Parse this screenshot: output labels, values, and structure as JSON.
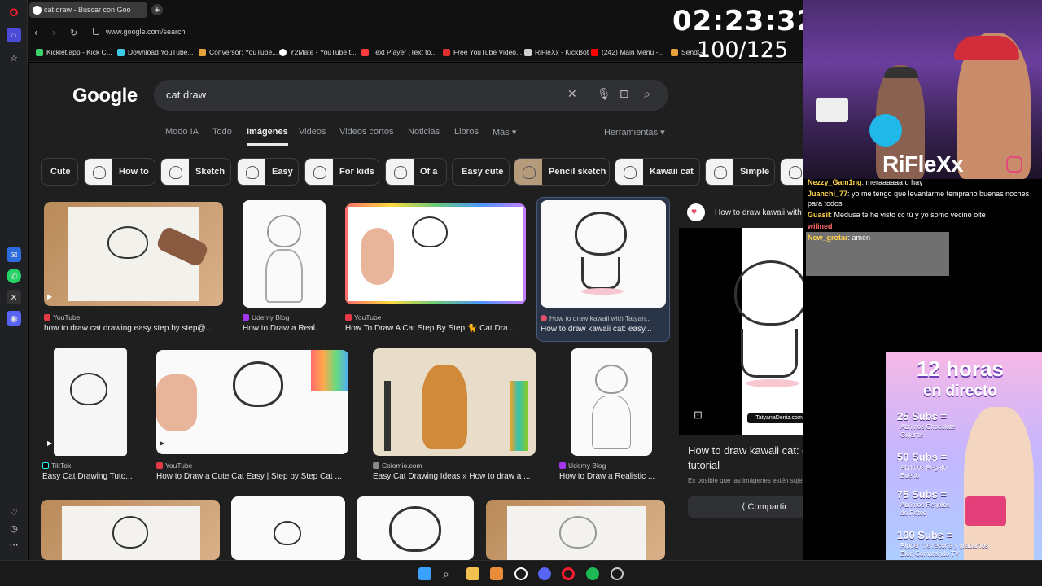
{
  "browser": {
    "tab_title": "cat draw - Buscar con Goo",
    "url": "www.google.com/search",
    "bookmarks": [
      {
        "label": "Kicklet.app - Kick C...",
        "color": "#3ad16b"
      },
      {
        "label": "Download YouTube...",
        "color": "#3ecbe6"
      },
      {
        "label": "Conversor: YouTube...",
        "color": "#e2a33a"
      },
      {
        "label": "Y2Mate - YouTube t...",
        "color": "#ffffff"
      },
      {
        "label": "Text Player (Text to...",
        "color": "#ff3b3b"
      },
      {
        "label": "Free YouTube Video...",
        "color": "#e03131"
      },
      {
        "label": "RiFleXx - KickBot",
        "color": "#d0d0d0"
      },
      {
        "label": "(242) Main Menu -...",
        "color": "#ff0000"
      },
      {
        "label": "SendG...",
        "color": "#e8a33a"
      }
    ]
  },
  "google": {
    "logo": "Google",
    "query": "cat draw",
    "tabs": [
      "Modo IA",
      "Todo",
      "Imágenes",
      "Videos",
      "Videos cortos",
      "Noticias",
      "Libros",
      "Más ▾"
    ],
    "active_tab": "Imágenes",
    "tools": "Herramientas ▾",
    "chips": [
      "Cute",
      "How to",
      "Sketch",
      "Easy",
      "For kids",
      "Of a",
      "Easy cute",
      "Pencil sketch",
      "Kawaii cat",
      "Simple"
    ],
    "results_row1": [
      {
        "source": "YouTube",
        "title": "how to draw cat drawing easy step by step@..."
      },
      {
        "source": "Udemy Blog",
        "title": "How to Draw a Real..."
      },
      {
        "source": "YouTube",
        "title": "How To Draw A Cat Step By Step 🐈 Cat Dra..."
      },
      {
        "source": "How to draw kawaii with Tatyan...",
        "title": "How to draw kawaii cat: easy..."
      }
    ],
    "results_row2": [
      {
        "source": "TikTok",
        "title": "Easy Cat Drawing Tuto..."
      },
      {
        "source": "YouTube",
        "title": "How to Draw a Cute Cat Easy | Step by Step Cat ..."
      },
      {
        "source": "Colomio.com",
        "title": "Easy Cat Drawing Ideas » How to draw a ..."
      },
      {
        "source": "Udemy Blog",
        "title": "How to Draw a Realistic ..."
      }
    ]
  },
  "preview": {
    "site": "How to draw kawaii with Tatyana Deniz",
    "title": "How to draw kawaii cat: easy step-by-step tutorial",
    "note": "Es posible que las imágenes estén sujetas a derechos de autor.",
    "share_label": "Compartir",
    "watermark": "TatyanaDeniz.com"
  },
  "overlay": {
    "timer": "02:23:32",
    "counter": "100/125",
    "streamer": "RiFleXx"
  },
  "chat": [
    {
      "user": "Nezzy_Gam1ng",
      "text": ": meraaaaaa q hay"
    },
    {
      "user": "Juanchi_77",
      "text": ": yo me tengo que levantarme temprano buenas noches para todos"
    },
    {
      "user": "Guasil",
      "text": ": Medusa te he visto cc tú y yo somo vecino oite"
    },
    {
      "user": "wilined",
      "text": ""
    },
    {
      "user": "New_grotar",
      "text": ": amen"
    }
  ],
  "promo": {
    "headline_1": "12 horas",
    "headline_2": "en directo",
    "tiers": [
      {
        "subs": "25 Subs =",
        "reward": "Abrimos Chocolate Gigante"
      },
      {
        "subs": "50 Subs =",
        "reward": "Abrimos Regalo Bueno"
      },
      {
        "subs": "75 Subs =",
        "reward": "Abrimos Regalos de Retos"
      },
      {
        "subs": "100 Subs =",
        "reward": "Ripper me recorta y grabamos Blog Comprando TV"
      }
    ]
  }
}
